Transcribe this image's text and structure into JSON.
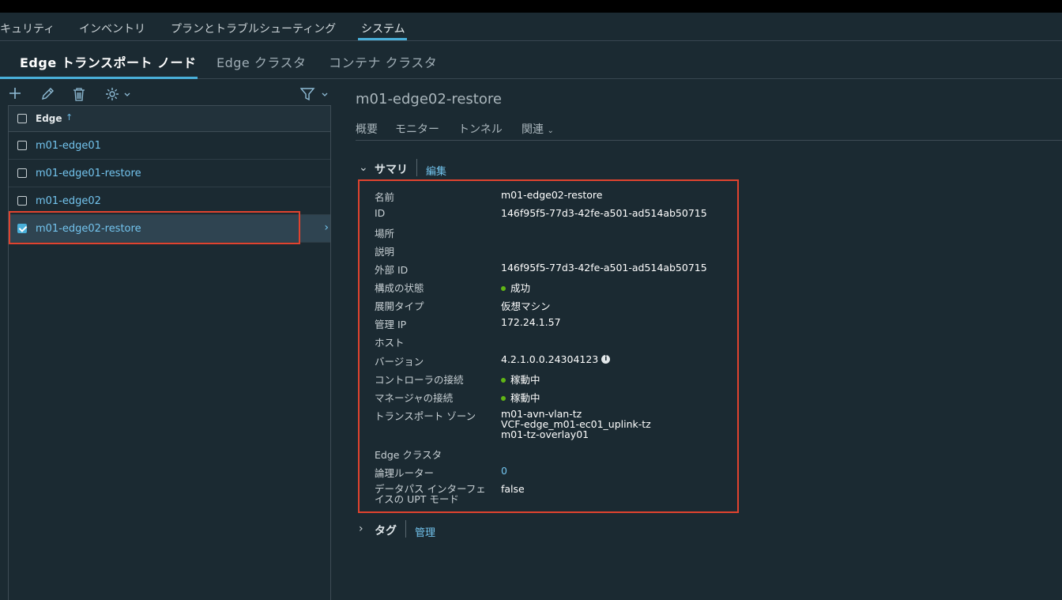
{
  "top_nav": {
    "items": [
      {
        "label": "キュリティ",
        "active": false
      },
      {
        "label": "インベントリ",
        "active": false
      },
      {
        "label": "プランとトラブルシューティング",
        "active": false
      },
      {
        "label": "システム",
        "active": true
      }
    ]
  },
  "sub_nav": {
    "items": [
      {
        "label": "Edge トランスポート ノード",
        "active": true
      },
      {
        "label": "Edge クラスタ",
        "active": false
      },
      {
        "label": "コンテナ クラスタ",
        "active": false
      }
    ]
  },
  "toolbar": {
    "icons": [
      "add-icon",
      "edit-icon",
      "delete-icon",
      "gear-icon",
      "filter-icon"
    ]
  },
  "grid": {
    "column_header": "Edge",
    "sort_direction": "ascending",
    "rows": [
      {
        "label": "m01-edge01",
        "checked": false,
        "selected": false
      },
      {
        "label": "m01-edge01-restore",
        "checked": false,
        "selected": false
      },
      {
        "label": "m01-edge02",
        "checked": false,
        "selected": false
      },
      {
        "label": "m01-edge02-restore",
        "checked": true,
        "selected": true
      }
    ]
  },
  "detail": {
    "title": "m01-edge02-restore",
    "tabs": [
      "概要",
      "モニター",
      "トンネル",
      "関連"
    ],
    "summary_section": {
      "title": "サマリ",
      "link": "編集",
      "expanded": true
    },
    "tag_section": {
      "title": "タグ",
      "link": "管理",
      "expanded": false
    },
    "fields": [
      {
        "label": "名前",
        "value": "m01-edge02-restore"
      },
      {
        "label": "ID",
        "value": "146f95f5-77d3-42fe-a501-ad514ab50715"
      },
      {
        "label": "場所",
        "value": ""
      },
      {
        "label": "説明",
        "value": ""
      },
      {
        "label": "外部 ID",
        "value": "146f95f5-77d3-42fe-a501-ad514ab50715"
      },
      {
        "label": "構成の状態",
        "value": "成功",
        "status": "green"
      },
      {
        "label": "展開タイプ",
        "value": "仮想マシン"
      },
      {
        "label": "管理 IP",
        "value": "172.24.1.57"
      },
      {
        "label": "ホスト",
        "value": ""
      },
      {
        "label": "バージョン",
        "value": "4.2.1.0.0.24304123",
        "info_icon": true
      },
      {
        "label": "コントローラの接続",
        "value": "稼動中",
        "status": "green"
      },
      {
        "label": "マネージャの接続",
        "value": "稼動中",
        "status": "green"
      },
      {
        "label": "トランスポート ゾーン",
        "values": [
          "m01-avn-vlan-tz",
          "VCF-edge_m01-ec01_uplink-tz",
          "m01-tz-overlay01"
        ]
      },
      {
        "label": "Edge クラスタ",
        "value": ""
      },
      {
        "label": "論理ルーター",
        "value": "0",
        "link": true
      },
      {
        "label_lines": [
          "データパス インターフェ",
          "イスの UPT モード"
        ],
        "value": "false"
      }
    ]
  },
  "colors": {
    "accent": "#49afd9",
    "link": "#73c4ee",
    "highlight_box": "#e0432f",
    "status_green": "#60b515",
    "background": "#1b2a32"
  }
}
